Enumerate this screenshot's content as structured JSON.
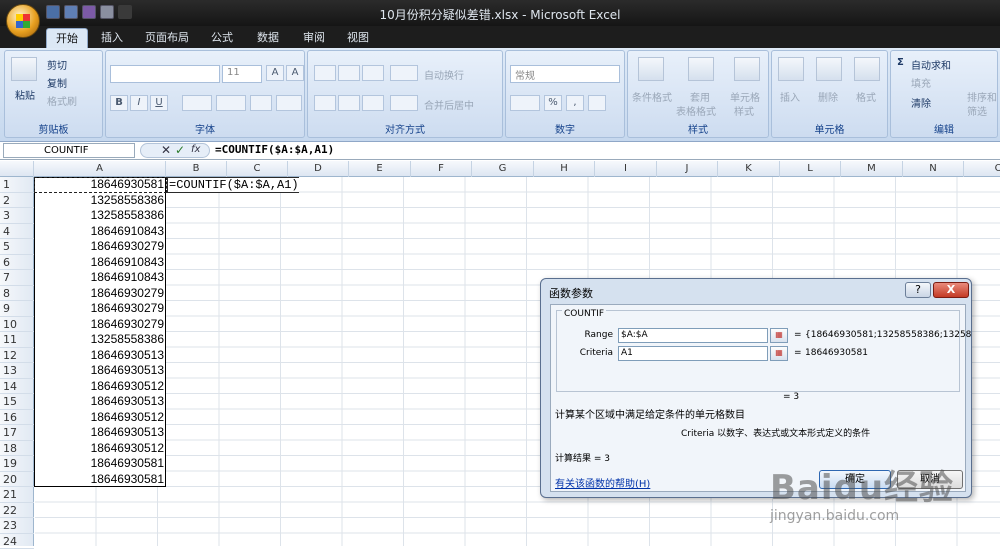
{
  "window": {
    "title": "10月份积分疑似差错.xlsx - Microsoft Excel"
  },
  "ribbon_tabs": [
    "开始",
    "插入",
    "页面布局",
    "公式",
    "数据",
    "审阅",
    "视图"
  ],
  "ribbon": {
    "clipboard": {
      "label": "剪贴板",
      "paste": "粘贴",
      "cut": "剪切",
      "copy": "复制",
      "format_painter": "格式刷"
    },
    "font": {
      "label": "字体",
      "size": "11",
      "bold": "B",
      "italic": "I",
      "underline": "U",
      "grow": "A",
      "shrink": "A"
    },
    "alignment": {
      "label": "对齐方式",
      "wrap": "自动换行",
      "merge": "合并后居中"
    },
    "number": {
      "label": "数字",
      "format": "常规",
      "percent": "%",
      "comma": ","
    },
    "styles": {
      "label": "样式",
      "cond": "条件格式",
      "table1": "套用",
      "table2": "表格格式",
      "cell1": "单元格",
      "cell2": "样式"
    },
    "cells": {
      "label": "单元格",
      "insert": "插入",
      "delete": "删除",
      "format": "格式"
    },
    "editing": {
      "label": "编辑",
      "autosum": "自动求和",
      "fill": "填充",
      "clear": "清除",
      "sort1": "排序和",
      "sort2": "筛选"
    }
  },
  "formula_bar": {
    "name_box": "COUNTIF",
    "formula": "=COUNTIF($A:$A,A1)",
    "cancel_glyph": "✕",
    "enter_glyph": "✓",
    "fx": "fx"
  },
  "columns": [
    "A",
    "B",
    "C",
    "D",
    "E",
    "F",
    "G",
    "H",
    "I",
    "J",
    "K",
    "L",
    "M",
    "N",
    "O"
  ],
  "rows": [
    "1",
    "2",
    "3",
    "4",
    "5",
    "6",
    "7",
    "8",
    "9",
    "10",
    "11",
    "12",
    "13",
    "14",
    "15",
    "16",
    "17",
    "18",
    "19",
    "20",
    "21",
    "22",
    "23",
    "24"
  ],
  "cells_a": [
    "18646930581",
    "13258558386",
    "13258558386",
    "18646910843",
    "18646930279",
    "18646910843",
    "18646910843",
    "18646930279",
    "18646930279",
    "18646930279",
    "13258558386",
    "18646930513",
    "18646930513",
    "18646930512",
    "18646930513",
    "18646930512",
    "18646930513",
    "18646930512",
    "18646930581",
    "18646930581"
  ],
  "cell_b1": "=COUNTIF($A:$A,A1)",
  "dialog": {
    "title": "函数参数",
    "help_glyph": "?",
    "close_glyph": "X",
    "function_name": "COUNTIF",
    "range_label": "Range",
    "range_value": "$A:$A",
    "range_result": "{18646930581;13258558386;13258",
    "criteria_label": "Criteria",
    "criteria_value": "A1",
    "criteria_result": "18646930581",
    "equals": "=",
    "result_eq": "= 3",
    "description": "计算某个区域中满足给定条件的单元格数目",
    "param_desc": "Criteria  以数字、表达式或文本形式定义的条件",
    "calc_result": "计算结果 = 3",
    "help_link": "有关该函数的帮助(H)",
    "ok": "确定",
    "cancel": "取消"
  },
  "watermark": {
    "logo": "Baidu经验",
    "url": "jingyan.baidu.com"
  },
  "colors": {
    "titlebar": "#1d1d1d",
    "ribbon": "#dfeaf7",
    "selection": "#222222",
    "close": "#c33a24"
  }
}
